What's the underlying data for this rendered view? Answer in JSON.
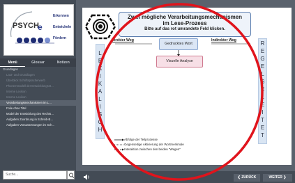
{
  "sidebar": {
    "logo": {
      "brand_name": "PSYCH",
      "brand_highlight": "e",
      "tagline": [
        "Erkennen",
        "Entwickeln",
        "Fördern"
      ]
    },
    "tabs": [
      "Menü",
      "Glossar",
      "Notizen"
    ],
    "menu_items": [
      {
        "label": "Grundlagen",
        "style": "top"
      },
      {
        "label": "Laut- und Grundlagen",
        "style": "dim"
      },
      {
        "label": "Überblick Schriftspracherwerb",
        "style": "dim"
      },
      {
        "label": "Phonemmodell der Entwicklungsst…",
        "style": "dim"
      },
      {
        "label": "Interne Lexikon",
        "style": "dim"
      },
      {
        "label": "Interne Lexikon",
        "style": "dim"
      },
      {
        "label": "Verarbeitungsmechanismen im L…",
        "style": "selected"
      },
      {
        "label": "Folie ohne Titel",
        "style": "bright"
      },
      {
        "label": "Model der Entwicklung des Rechts…",
        "style": "bright"
      },
      {
        "label": "Aufgaben Zuordnung in Schreib-B…",
        "style": "bright"
      },
      {
        "label": "Aufgaben Voraussetzungen im Sch…",
        "style": "bright"
      }
    ],
    "search_placeholder": "Suche...",
    "search_icon": "magnifier-icon"
  },
  "slide": {
    "title_line1": "Zwei mögliche Verarbeitungsmechanismen",
    "title_line2": "im Lese-Prozess",
    "title_line3": "Bitte auf das rot umrandete Feld klicken.",
    "left_route_label": "Direkter Weg",
    "right_route_label": "Indirekter Weg",
    "left_column_letters": [
      "L",
      "E",
      "X",
      "I",
      "K",
      "A",
      "L",
      "I",
      "S",
      "C",
      "H"
    ],
    "right_column_letters": [
      "R",
      "E",
      "G",
      "E",
      "L",
      "G",
      "E",
      "L",
      "E",
      "I",
      "T",
      "E",
      "T"
    ],
    "box_printed_word": "Gedrucktes Wort",
    "box_visual_analysis": "Visuelle Analyse",
    "legend": [
      {
        "line_style": "solid",
        "label": "Abfolge der Teilprozesse"
      },
      {
        "line_style": "dotted",
        "label": "Gegenseitige Aktivierung der Wortmerkmale"
      },
      {
        "line_style": "dashed",
        "label": "Interaktion zwischen den beiden \"Wegen\""
      }
    ]
  },
  "bottom_bar": {
    "audio_icon": "speaker-icon",
    "prev_label": "ZURÜCK",
    "next_label": "WEITER"
  },
  "colors": {
    "sidebar_bg": "#434b55",
    "content_frame_bg": "#5a626d",
    "highlight_circle": "#e0141c",
    "column_fill": "#d9e5f3",
    "visual_analysis_fill": "#f7dfe6"
  }
}
